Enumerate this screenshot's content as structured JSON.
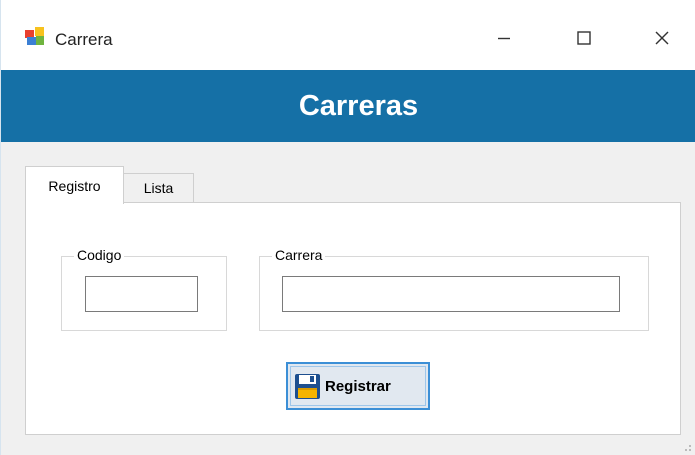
{
  "window": {
    "title": "Carrera",
    "caption_buttons": {
      "minimize_icon": "minimize-icon",
      "maximize_icon": "maximize-icon",
      "close_icon": "close-icon"
    }
  },
  "header": {
    "title": "Carreras",
    "background": "#1570a6"
  },
  "tabs": [
    {
      "label": "Registro",
      "selected": true
    },
    {
      "label": "Lista",
      "selected": false
    }
  ],
  "form": {
    "codigo": {
      "label": "Codigo",
      "value": ""
    },
    "carrera": {
      "label": "Carrera",
      "value": ""
    },
    "submit": {
      "label": "Registrar",
      "icon": "save-icon"
    }
  }
}
